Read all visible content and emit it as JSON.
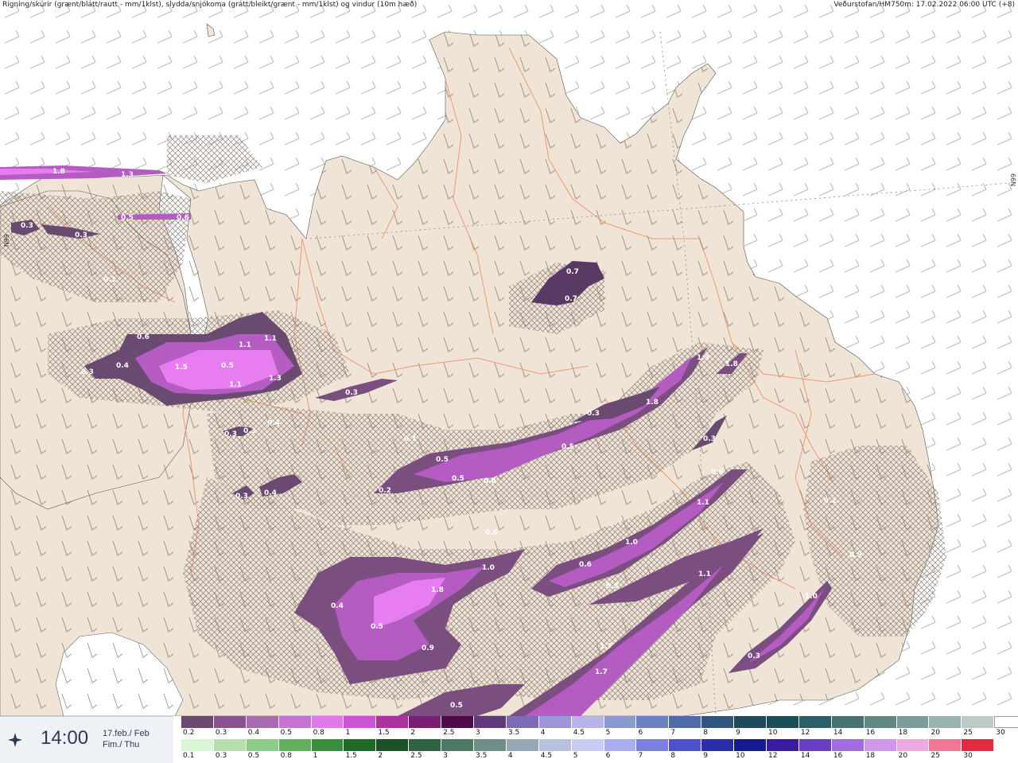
{
  "header": {
    "left": "Rigning/skúrir (grænt/blátt/rautt - mm/1klst), slydda/snjókoma (grátt/bleikt/grænt - mm/1klst) og vindur (10m hæð)",
    "right": "Veðurstofan/HM750m: 17.02.2022 06:00 UTC (+8)"
  },
  "latitude_labels": {
    "right": "66N",
    "left": "66N"
  },
  "time": {
    "value": "14:00",
    "date_line1": "17.feb./ Feb",
    "date_line2": "Fim./ Thu",
    "icon": "compass-icon"
  },
  "legend": {
    "snow": {
      "labels": [
        "0.2",
        "0.3",
        "0.4",
        "0.5",
        "0.8",
        "1",
        "1.5",
        "2",
        "2.5",
        "3",
        "3.5",
        "4",
        "4.5",
        "5",
        "6",
        "7",
        "8",
        "9",
        "10",
        "12",
        "14",
        "16",
        "18",
        "20",
        "25",
        "30"
      ],
      "colors": [
        "#6b4a72",
        "#8a5290",
        "#a86bb0",
        "#c572d0",
        "#e07ae8",
        "#cc55d6",
        "#a8329f",
        "#7a1e76",
        "#4e0a4a",
        "#5e3a7a",
        "#7d6bb6",
        "#9c95d8",
        "#b6b4ea",
        "#8a9ad0",
        "#6a82c2",
        "#4e6aa8",
        "#30557e",
        "#1f4a5c",
        "#1a4f57",
        "#2c5e66",
        "#46736f",
        "#5f8883",
        "#7b9d99",
        "#9ab3b0",
        "#bcc9c7",
        "#ffffff"
      ]
    },
    "rain": {
      "labels": [
        "0.1",
        "0.3",
        "0.5",
        "0.8",
        "1",
        "1.5",
        "2",
        "2.5",
        "3",
        "3.5",
        "4",
        "4.5",
        "5",
        "6",
        "7",
        "8",
        "9",
        "10",
        "12",
        "14",
        "16",
        "18",
        "20",
        "25",
        "30"
      ],
      "colors": [
        "#d8f5d4",
        "#b5e0ad",
        "#8dcc86",
        "#62b05e",
        "#3a8f3e",
        "#1d6b24",
        "#1a5226",
        "#2e6242",
        "#4b7a62",
        "#6f8e87",
        "#95a8b6",
        "#b7c0dc",
        "#c9ccf2",
        "#a9acee",
        "#7c80e0",
        "#4d52c8",
        "#2a2ea8",
        "#151a8c",
        "#3a1c9e",
        "#6a3ec2",
        "#a06ce0",
        "#cf96ec",
        "#f0a8e0",
        "#f07896",
        "#ea2840"
      ]
    }
  },
  "precip_labels": [
    "1.8",
    "1.3",
    "0.3",
    "0.3",
    "0.5",
    "0.6",
    "0.3",
    "0.7",
    "0.6",
    "1.1",
    "1.1",
    "0.4",
    "1.5",
    "0.5",
    "1.3",
    "1.1",
    "0.4",
    "0.3",
    "1.3",
    "1.8",
    "0.3",
    "1.8",
    "0.3",
    "0.3",
    "0.3",
    "0.4",
    "0.3",
    "0.1",
    "0.5",
    "0.5",
    "0.5",
    "0.6",
    "0.2",
    "0.6",
    "1.1",
    "0.1",
    "0.9",
    "1.0",
    "0.6",
    "0.3",
    "1.0",
    "1.1",
    "1.8",
    "0.4",
    "0.5",
    "0.9",
    "0.7",
    "1.0",
    "1.7",
    "1.7",
    "0.3",
    "0.5",
    "0.1",
    "0.6"
  ],
  "colors": {
    "land": "#f0e4d7",
    "sea": "#ffffff",
    "roads": "#ef8f65",
    "hatch": "#8c7f75",
    "wind": "#8a8a8a",
    "precip_light": "#7a4f80",
    "precip_dark": "#5a3a65",
    "precip_mid": "#b45cc2",
    "precip_strong": "#e77df0"
  }
}
